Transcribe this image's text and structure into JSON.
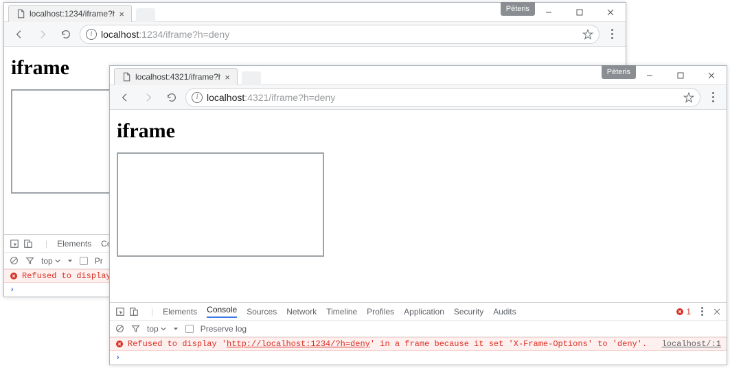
{
  "user_badge": "Pēteris",
  "window1": {
    "tab": {
      "title": "localhost:1234/iframe?h="
    },
    "url": {
      "host": "localhost",
      "portpath": ":1234/iframe?h=deny"
    },
    "page": {
      "heading": "iframe"
    },
    "devtools": {
      "tabs": [
        "Elements",
        "Co"
      ],
      "top_label": "top",
      "preserve": "Pr",
      "error_msg": "Refused to display "
    }
  },
  "window2": {
    "tab": {
      "title": "localhost:4321/iframe?h="
    },
    "url": {
      "host": "localhost",
      "portpath": ":4321/iframe?h=deny"
    },
    "page": {
      "heading": "iframe"
    },
    "devtools": {
      "tabs": [
        "Elements",
        "Console",
        "Sources",
        "Network",
        "Timeline",
        "Profiles",
        "Application",
        "Security",
        "Audits"
      ],
      "active_tab_index": 1,
      "error_count": "1",
      "top_label": "top",
      "preserve": "Preserve log",
      "error_prefix": "Refused to display '",
      "error_url": "http://localhost:1234/?h=deny",
      "error_suffix": "' in a frame because it set 'X-Frame-Options' to 'deny'.",
      "source": "localhost/:1"
    }
  }
}
